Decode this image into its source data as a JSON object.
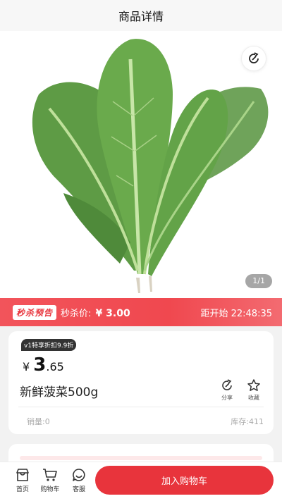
{
  "header": {
    "title": "商品详情"
  },
  "gallery": {
    "page_indicator": "1/1",
    "share_icon": "share-icon"
  },
  "flash_sale": {
    "tag": "秒杀预告",
    "price_label": "秒杀价:",
    "price": "¥ 3.00",
    "countdown_label": "距开始",
    "countdown": "22:48:35"
  },
  "product": {
    "member_badge": "v1特享折扣9.9折",
    "currency": "¥",
    "price_int": "3",
    "price_dec": ".65",
    "name": "新鲜菠菜500g",
    "share_label": "分享",
    "favorite_label": "收藏",
    "sales": "销量:0",
    "stock": "库存:411"
  },
  "bottom_bar": {
    "home_label": "首页",
    "cart_label": "购物车",
    "service_label": "客服",
    "add_to_cart": "加入购物车"
  },
  "colors": {
    "accent": "#e8343c",
    "flash_bg": "#f0484f"
  }
}
